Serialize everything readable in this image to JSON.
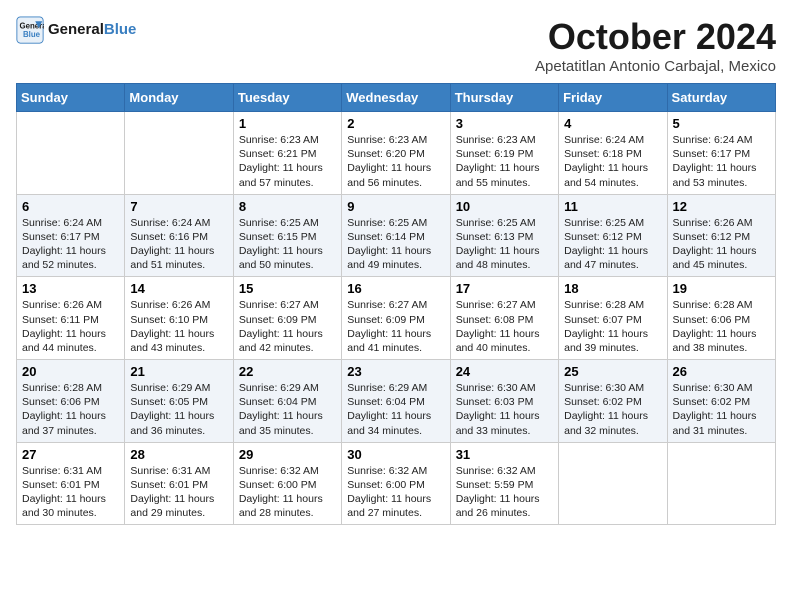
{
  "header": {
    "logo_line1": "General",
    "logo_line2": "Blue",
    "month": "October 2024",
    "location": "Apetatitlan Antonio Carbajal, Mexico"
  },
  "weekdays": [
    "Sunday",
    "Monday",
    "Tuesday",
    "Wednesday",
    "Thursday",
    "Friday",
    "Saturday"
  ],
  "weeks": [
    [
      {
        "day": "",
        "content": ""
      },
      {
        "day": "",
        "content": ""
      },
      {
        "day": "1",
        "sunrise": "6:23 AM",
        "sunset": "6:21 PM",
        "daylight": "11 hours and 57 minutes."
      },
      {
        "day": "2",
        "sunrise": "6:23 AM",
        "sunset": "6:20 PM",
        "daylight": "11 hours and 56 minutes."
      },
      {
        "day": "3",
        "sunrise": "6:23 AM",
        "sunset": "6:19 PM",
        "daylight": "11 hours and 55 minutes."
      },
      {
        "day": "4",
        "sunrise": "6:24 AM",
        "sunset": "6:18 PM",
        "daylight": "11 hours and 54 minutes."
      },
      {
        "day": "5",
        "sunrise": "6:24 AM",
        "sunset": "6:17 PM",
        "daylight": "11 hours and 53 minutes."
      }
    ],
    [
      {
        "day": "6",
        "sunrise": "6:24 AM",
        "sunset": "6:17 PM",
        "daylight": "11 hours and 52 minutes."
      },
      {
        "day": "7",
        "sunrise": "6:24 AM",
        "sunset": "6:16 PM",
        "daylight": "11 hours and 51 minutes."
      },
      {
        "day": "8",
        "sunrise": "6:25 AM",
        "sunset": "6:15 PM",
        "daylight": "11 hours and 50 minutes."
      },
      {
        "day": "9",
        "sunrise": "6:25 AM",
        "sunset": "6:14 PM",
        "daylight": "11 hours and 49 minutes."
      },
      {
        "day": "10",
        "sunrise": "6:25 AM",
        "sunset": "6:13 PM",
        "daylight": "11 hours and 48 minutes."
      },
      {
        "day": "11",
        "sunrise": "6:25 AM",
        "sunset": "6:12 PM",
        "daylight": "11 hours and 47 minutes."
      },
      {
        "day": "12",
        "sunrise": "6:26 AM",
        "sunset": "6:12 PM",
        "daylight": "11 hours and 45 minutes."
      }
    ],
    [
      {
        "day": "13",
        "sunrise": "6:26 AM",
        "sunset": "6:11 PM",
        "daylight": "11 hours and 44 minutes."
      },
      {
        "day": "14",
        "sunrise": "6:26 AM",
        "sunset": "6:10 PM",
        "daylight": "11 hours and 43 minutes."
      },
      {
        "day": "15",
        "sunrise": "6:27 AM",
        "sunset": "6:09 PM",
        "daylight": "11 hours and 42 minutes."
      },
      {
        "day": "16",
        "sunrise": "6:27 AM",
        "sunset": "6:09 PM",
        "daylight": "11 hours and 41 minutes."
      },
      {
        "day": "17",
        "sunrise": "6:27 AM",
        "sunset": "6:08 PM",
        "daylight": "11 hours and 40 minutes."
      },
      {
        "day": "18",
        "sunrise": "6:28 AM",
        "sunset": "6:07 PM",
        "daylight": "11 hours and 39 minutes."
      },
      {
        "day": "19",
        "sunrise": "6:28 AM",
        "sunset": "6:06 PM",
        "daylight": "11 hours and 38 minutes."
      }
    ],
    [
      {
        "day": "20",
        "sunrise": "6:28 AM",
        "sunset": "6:06 PM",
        "daylight": "11 hours and 37 minutes."
      },
      {
        "day": "21",
        "sunrise": "6:29 AM",
        "sunset": "6:05 PM",
        "daylight": "11 hours and 36 minutes."
      },
      {
        "day": "22",
        "sunrise": "6:29 AM",
        "sunset": "6:04 PM",
        "daylight": "11 hours and 35 minutes."
      },
      {
        "day": "23",
        "sunrise": "6:29 AM",
        "sunset": "6:04 PM",
        "daylight": "11 hours and 34 minutes."
      },
      {
        "day": "24",
        "sunrise": "6:30 AM",
        "sunset": "6:03 PM",
        "daylight": "11 hours and 33 minutes."
      },
      {
        "day": "25",
        "sunrise": "6:30 AM",
        "sunset": "6:02 PM",
        "daylight": "11 hours and 32 minutes."
      },
      {
        "day": "26",
        "sunrise": "6:30 AM",
        "sunset": "6:02 PM",
        "daylight": "11 hours and 31 minutes."
      }
    ],
    [
      {
        "day": "27",
        "sunrise": "6:31 AM",
        "sunset": "6:01 PM",
        "daylight": "11 hours and 30 minutes."
      },
      {
        "day": "28",
        "sunrise": "6:31 AM",
        "sunset": "6:01 PM",
        "daylight": "11 hours and 29 minutes."
      },
      {
        "day": "29",
        "sunrise": "6:32 AM",
        "sunset": "6:00 PM",
        "daylight": "11 hours and 28 minutes."
      },
      {
        "day": "30",
        "sunrise": "6:32 AM",
        "sunset": "6:00 PM",
        "daylight": "11 hours and 27 minutes."
      },
      {
        "day": "31",
        "sunrise": "6:32 AM",
        "sunset": "5:59 PM",
        "daylight": "11 hours and 26 minutes."
      },
      {
        "day": "",
        "content": ""
      },
      {
        "day": "",
        "content": ""
      }
    ]
  ]
}
